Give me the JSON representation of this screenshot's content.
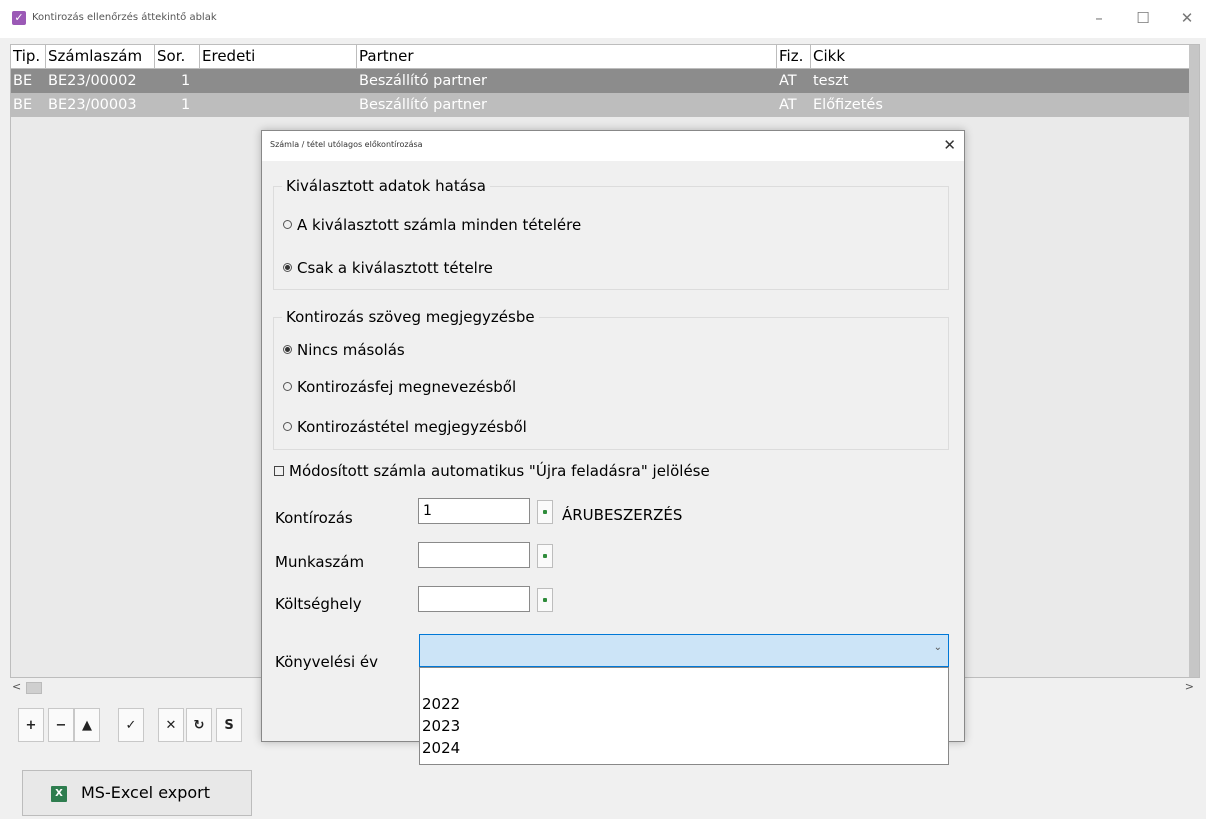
{
  "window": {
    "title": "Kontirozás ellenőrzés áttekintő ablak",
    "minimize": "–",
    "maximize": "☐",
    "close": "✕"
  },
  "grid": {
    "columns": [
      "Tip.",
      "Számlaszám",
      "Sor.",
      "Eredeti",
      "Partner",
      "Fiz.",
      "Cikk"
    ],
    "rows": [
      {
        "tip": "BE",
        "szamlaszam": "BE23/00002",
        "sor": "1",
        "eredeti": "",
        "partner": "Beszállító partner",
        "fiz": "AT",
        "cikk": "teszt"
      },
      {
        "tip": "BE",
        "szamlaszam": "BE23/00003",
        "sor": "1",
        "eredeti": "",
        "partner": "Beszállító partner",
        "fiz": "AT",
        "cikk": "Előfizetés"
      }
    ]
  },
  "scrollbar": {
    "left_arrow": "<",
    "right_arrow": ">"
  },
  "toolbar": {
    "buttons": [
      "+",
      "−",
      "▲",
      "✓",
      "✕",
      "↻",
      "S"
    ]
  },
  "excel_export": {
    "label": "MS-Excel export",
    "icon_text": "X"
  },
  "dialog": {
    "title": "Számla / tétel utólagos előkontírozása",
    "close": "✕",
    "group1": {
      "title": "Kiválasztott adatok hatása",
      "options": [
        {
          "label": "A kiválasztott számla minden tételére",
          "checked": false
        },
        {
          "label": "Csak a kiválasztott tételre",
          "checked": true
        }
      ]
    },
    "group2": {
      "title": "Kontirozás szöveg megjegyzésbe",
      "options": [
        {
          "label": "Nincs másolás",
          "checked": true
        },
        {
          "label": "Kontirozásfej megnevezésből",
          "checked": false
        },
        {
          "label": "Kontirozástétel megjegyzésből",
          "checked": false
        }
      ]
    },
    "checkbox_label": "Módosított számla automatikus \"Újra feladásra\" jelölése",
    "fields": {
      "kontirozas_label": "Kontírozás",
      "kontirozas_value": "1",
      "kontirozas_lookup": "ÁRUBESZERZÉS",
      "munkaszam_label": "Munkaszám",
      "munkaszam_value": "",
      "koltseghely_label": "Költséghely",
      "koltseghely_value": "",
      "konyvelesi_ev_label": "Könyvelési év",
      "konyvelesi_ev_value": ""
    },
    "year_options": [
      "2022",
      "2023",
      "2024"
    ]
  },
  "colors": {
    "row1_bg": "#8c8c8c",
    "row2_bg": "#bdbdbd",
    "select_bg": "#cce4f7",
    "select_border": "#0078d7"
  }
}
